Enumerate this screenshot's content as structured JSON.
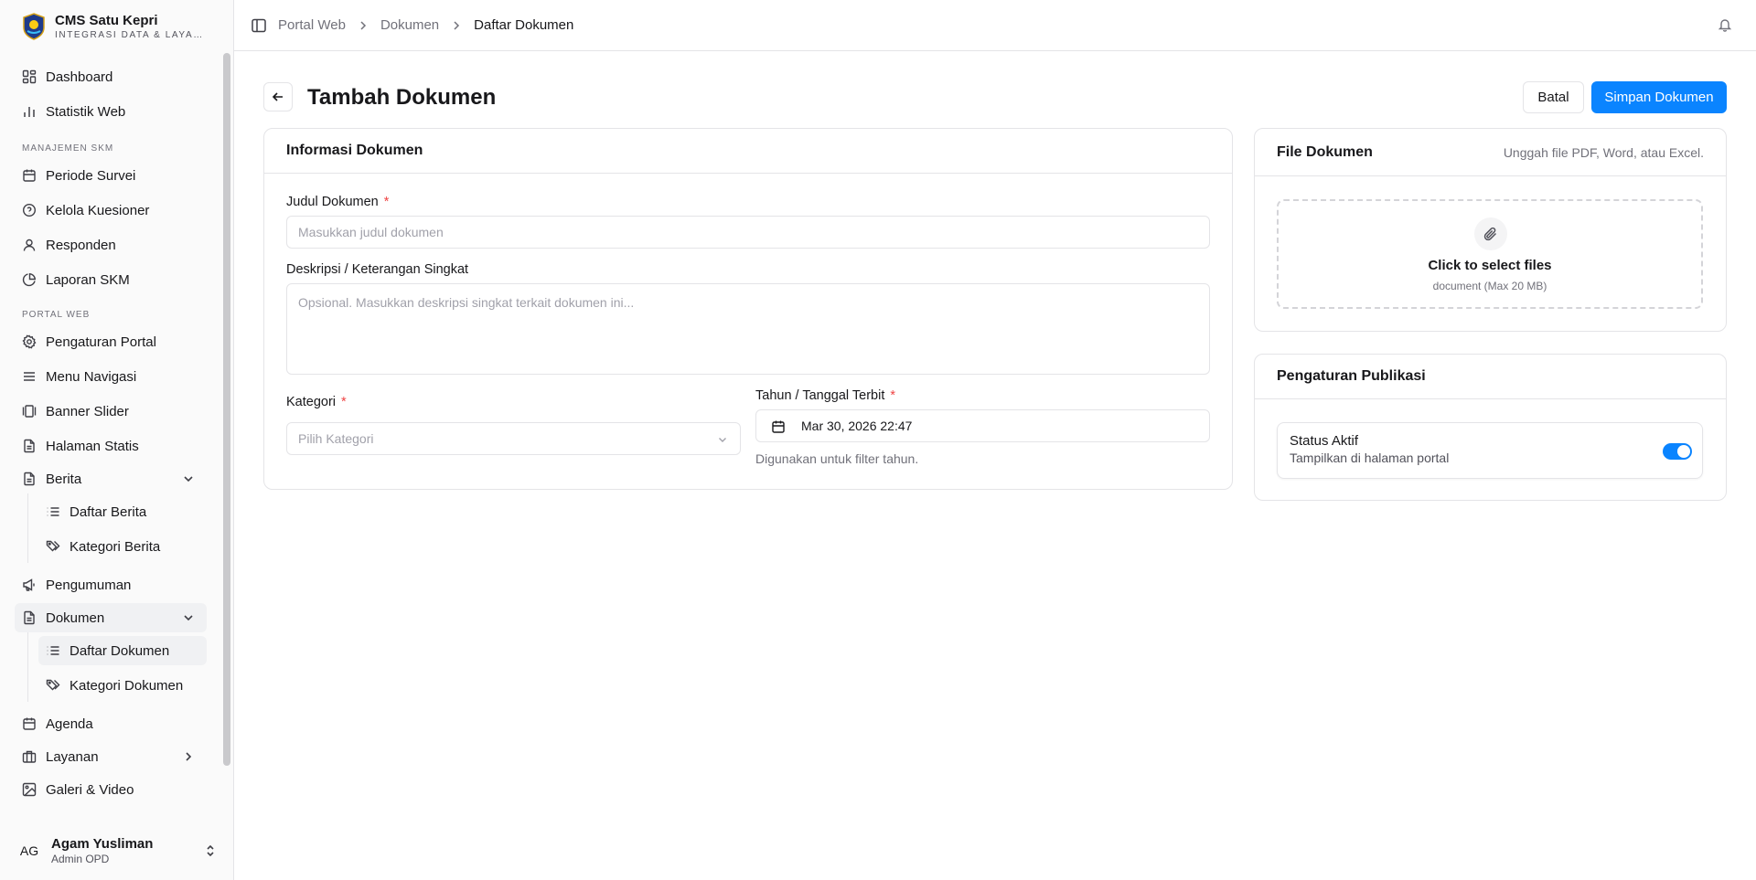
{
  "app": {
    "title": "CMS Satu Kepri",
    "subtitle": "INTEGRASI DATA & LAYANAN"
  },
  "sidebar": {
    "items": [
      {
        "label": "Dashboard",
        "icon": "layout-dashboard-icon"
      },
      {
        "label": "Statistik Web",
        "icon": "bar-chart-icon"
      },
      {
        "label": "Periode Survei",
        "icon": "calendar-icon"
      },
      {
        "label": "Kelola Kuesioner",
        "icon": "help-circle-icon"
      },
      {
        "label": "Responden",
        "icon": "user-icon"
      },
      {
        "label": "Laporan SKM",
        "icon": "pie-chart-icon"
      },
      {
        "label": "Pengaturan Portal",
        "icon": "settings-icon"
      },
      {
        "label": "Menu Navigasi",
        "icon": "menu-icon"
      },
      {
        "label": "Banner Slider",
        "icon": "gallery-icon"
      },
      {
        "label": "Halaman Statis",
        "icon": "file-icon"
      },
      {
        "label": "Berita",
        "icon": "file-text-icon"
      },
      {
        "label": "Daftar Berita",
        "icon": "list-icon"
      },
      {
        "label": "Kategori Berita",
        "icon": "tags-icon"
      },
      {
        "label": "Pengumuman",
        "icon": "megaphone-icon"
      },
      {
        "label": "Dokumen",
        "icon": "file-text-icon"
      },
      {
        "label": "Daftar Dokumen",
        "icon": "list-icon"
      },
      {
        "label": "Kategori Dokumen",
        "icon": "tags-icon"
      },
      {
        "label": "Agenda",
        "icon": "calendar-icon"
      },
      {
        "label": "Layanan",
        "icon": "briefcase-icon"
      },
      {
        "label": "Galeri & Video",
        "icon": "image-icon"
      }
    ],
    "groups": {
      "skm": "MANAJEMEN SKM",
      "portal": "PORTAL WEB"
    },
    "user": {
      "initials": "AG",
      "name": "Agam Yusliman",
      "role": "Admin OPD"
    }
  },
  "header": {
    "breadcrumb": [
      "Portal Web",
      "Dokumen",
      "Daftar Dokumen"
    ]
  },
  "page": {
    "title": "Tambah Dokumen",
    "cancel_label": "Batal",
    "save_label": "Simpan Dokumen"
  },
  "info_card": {
    "title": "Informasi Dokumen",
    "judul_label": "Judul Dokumen",
    "judul_placeholder": "Masukkan judul dokumen",
    "deskripsi_label": "Deskripsi / Keterangan Singkat",
    "deskripsi_placeholder": "Opsional. Masukkan deskripsi singkat terkait dokumen ini...",
    "kategori_label": "Kategori",
    "kategori_placeholder": "Pilih Kategori",
    "tanggal_label": "Tahun / Tanggal Terbit",
    "tanggal_value": "Mar 30, 2026 22:47",
    "tanggal_hint": "Digunakan untuk filter tahun.",
    "required_mark": "*"
  },
  "file_card": {
    "title": "File Dokumen",
    "description": "Unggah file PDF, Word, atau Excel.",
    "dropzone_title": "Click to select files",
    "dropzone_sub": "document (Max 20 MB)"
  },
  "publish_card": {
    "title": "Pengaturan Publikasi",
    "status_title": "Status Aktif",
    "status_sub": "Tampilkan di halaman portal",
    "status_on": true
  },
  "colors": {
    "accent": "#0a84ff",
    "required": "#ef4444",
    "border": "#e4e4e7"
  }
}
